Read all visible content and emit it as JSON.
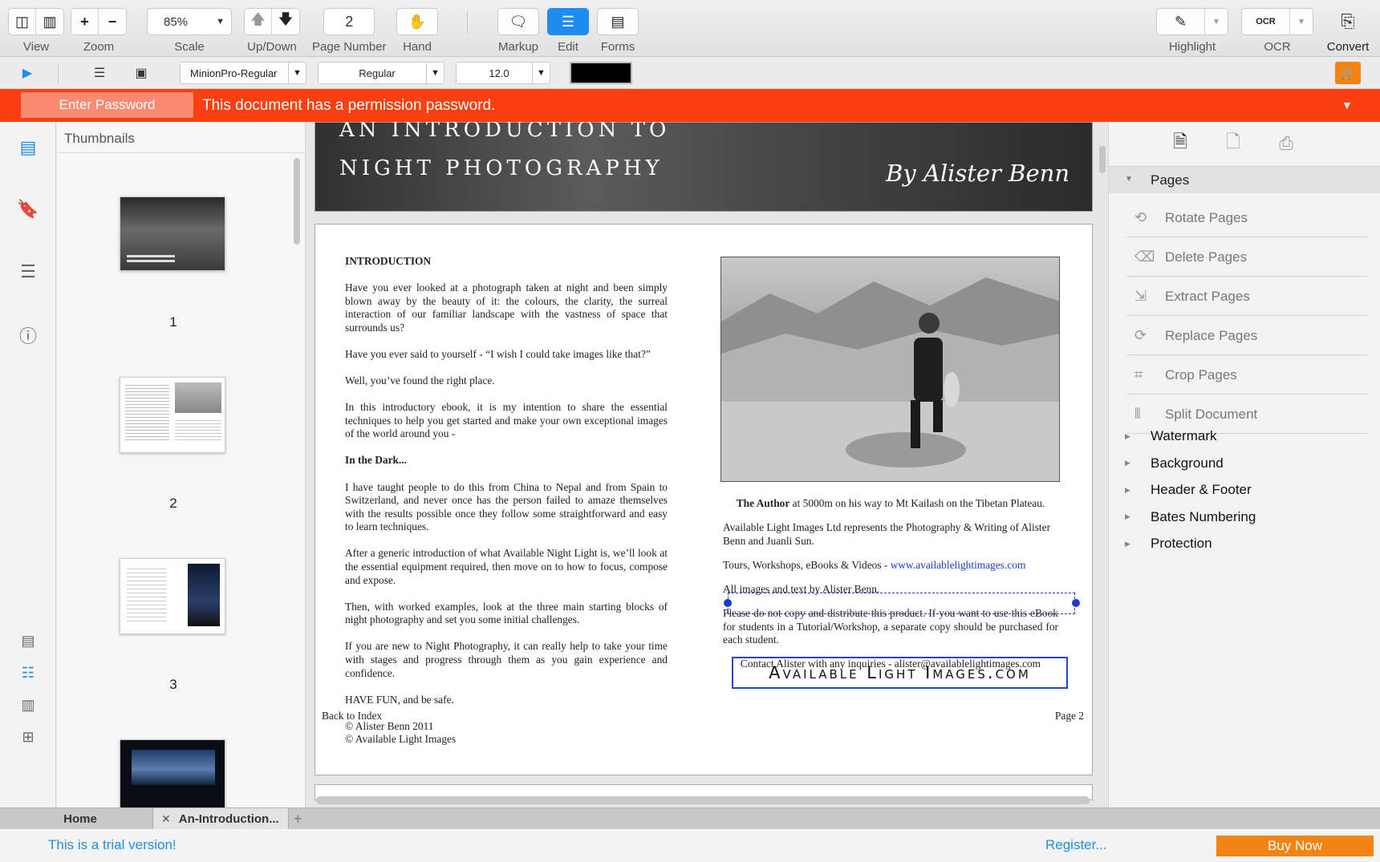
{
  "toolbar": {
    "view_label": "View",
    "zoom_label": "Zoom",
    "scale_label": "Scale",
    "scale_value": "85%",
    "updown_label": "Up/Down",
    "page_number_label": "Page Number",
    "page_number_value": "2",
    "hand_label": "Hand",
    "markup_label": "Markup",
    "edit_label": "Edit",
    "forms_label": "Forms",
    "highlight_label": "Highlight",
    "ocr_label": "OCR",
    "ocr_icon_text": "OCR",
    "convert_label": "Convert",
    "accent_color": "#1e8cf0"
  },
  "formatbar": {
    "font_family": "MinionPro-Regular",
    "font_style": "Regular",
    "font_size": "12.0",
    "text_color": "#000000"
  },
  "notice": {
    "button_label": "Enter Password",
    "message": "This document has a permission password.",
    "color": "#fa3f10"
  },
  "thumbnails": {
    "title": "Thumbnails",
    "pages": [
      {
        "number": "1"
      },
      {
        "number": "2"
      },
      {
        "number": "3"
      }
    ]
  },
  "document": {
    "banner": {
      "line1": "An Introduction to",
      "line2": "Night Photography",
      "author": "By Alister Benn"
    },
    "left_column": [
      {
        "style": "heading",
        "text": "INTRODUCTION"
      },
      {
        "style": "body",
        "text": "Have you ever looked at a photograph taken at night and been simply blown away by the beauty of it: the colours, the clarity, the surreal interaction of our familiar landscape with the vastness of space that surrounds us?"
      },
      {
        "style": "body",
        "text": "Have you ever said to yourself - “I wish I could take images like that?”"
      },
      {
        "style": "body",
        "text": "Well, you’ve found the right place."
      },
      {
        "style": "body",
        "text": "In this introductory ebook, it is my intention to share the essential techniques to help you get started and make your own exceptional images of the world around you -"
      },
      {
        "style": "heading",
        "text": "In the Dark..."
      },
      {
        "style": "body",
        "text": "I have taught people to do this from China to Nepal and from Spain to Switzerland, and never once has the person failed to amaze themselves with the results possible once they follow some straightforward and easy to learn techniques."
      },
      {
        "style": "body",
        "text": "After a generic introduction of what Available Night Light is, we’ll look at the essential equipment required, then move on to how to focus, compose and expose."
      },
      {
        "style": "body",
        "text": "Then, with worked examples, look at the three main starting blocks of night photography and set you some initial challenges."
      },
      {
        "style": "body",
        "text": "If you are new to Night Photography, it can really help to take your time with stages and progress through them as you gain experience and confidence."
      },
      {
        "style": "body",
        "text": "HAVE FUN, and be safe."
      }
    ],
    "copyright_1": "© Alister Benn 2011",
    "copyright_2": "© Available Light Images",
    "caption_bold": "The Author",
    "caption_rest": " at 5000m on his way to Mt Kailash on the Tibetan Plateau.",
    "represents": "Available Light Images Ltd represents the Photography & Writing of Alister Benn and Juanli Sun.",
    "tours_text": "Tours, Workshops, eBooks & Videos  - ",
    "tours_link": "www.availablelightimages.com",
    "all_images": "All images and text by Alister Benn.",
    "copy_notice": "Please do not copy and distribute this product. If you want to use this eBook for students in a Tutorial/Workshop, a separate copy should be purchased for each student.",
    "contact": "Contact Alister with any inquiries - alister@availablelightimages.com",
    "brand": "Available Light Images.com",
    "back_to_index": "Back to Index",
    "page_label": "Page 2"
  },
  "right_panel": {
    "section_title": "Pages",
    "page_tools": [
      {
        "label": "Rotate Pages",
        "icon": "rotate-pages-icon"
      },
      {
        "label": "Delete Pages",
        "icon": "delete-pages-icon"
      },
      {
        "label": "Extract Pages",
        "icon": "extract-pages-icon"
      },
      {
        "label": "Replace Pages",
        "icon": "replace-pages-icon"
      },
      {
        "label": "Crop Pages",
        "icon": "crop-pages-icon"
      },
      {
        "label": "Split Document",
        "icon": "split-document-icon"
      }
    ],
    "tree_items": [
      "Watermark",
      "Background",
      "Header & Footer",
      "Bates Numbering",
      "Protection"
    ]
  },
  "tabs": {
    "home": "Home",
    "document": "An-Introduction..."
  },
  "status": {
    "trial": "This is a trial version!",
    "register": "Register...",
    "buy": "Buy Now",
    "buy_color": "#f18412"
  }
}
